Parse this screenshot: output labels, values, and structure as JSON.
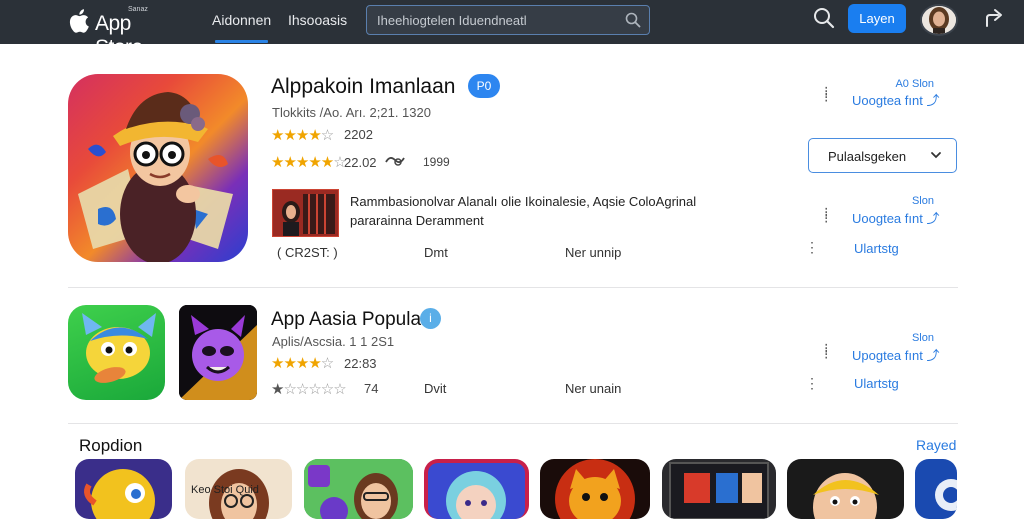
{
  "header": {
    "store_name": "App Store",
    "store_tag": "Sanaz",
    "tabs": [
      {
        "label": "Aidonnen",
        "active": true
      },
      {
        "label": "Ihsooasis",
        "active": false
      }
    ],
    "search_value": "Iheehiogtelen Iduendneatl",
    "login_label": "Layen",
    "icons": [
      "apple-logo-icon",
      "search-icon",
      "avatar",
      "share-icon"
    ]
  },
  "app1": {
    "title": "Alppakoin Imanlaan",
    "badge": "P0",
    "subtitle": "Tlokkits /Ao. Arı. 2;21. 1320",
    "rating_a": {
      "value": "2202",
      "filled": 4,
      "total": 5
    },
    "rating_b": {
      "value": "22.02",
      "filled": 4,
      "half": true
    },
    "download_count": "1999",
    "description_line1": "Rammbasionolvar Alanalı olie Ikoinalesie, Aqsie ColoAgrinal",
    "description_line2": "pararainna Deramment",
    "meta": [
      "( CR2ST: )",
      "Dmt",
      "Ner unnip"
    ],
    "side_rows": [
      {
        "small": "A0 Slon",
        "label": "Uoogtea fınt"
      },
      {
        "small": "Slon",
        "label": "Uoogtea fınt"
      }
    ],
    "dropdown_label": "Pulaalsgeken",
    "change_label": "Ulartstg"
  },
  "app2": {
    "title": "App Aasia Popular",
    "subtitle": "Aplis/Ascsia. 1 1 2S1",
    "rating_a": {
      "value": "22:83",
      "filled": 4,
      "half": true
    },
    "rating_b": {
      "value": "74",
      "filled": 1,
      "total": 5
    },
    "meta": [
      "Dvit",
      "Ner unain"
    ],
    "side_row": {
      "small": "Slon",
      "label": "Upogtea fınt"
    },
    "change_label": "Ulartstg"
  },
  "popular": {
    "title": "Ropdion",
    "see_all": "Rayed",
    "tile_caption": "Keo Stoi Quid"
  },
  "colors": {
    "topbar": "#2b3138",
    "accent": "#1a7ef0",
    "link": "#2a7be0",
    "star": "#f0a400"
  }
}
